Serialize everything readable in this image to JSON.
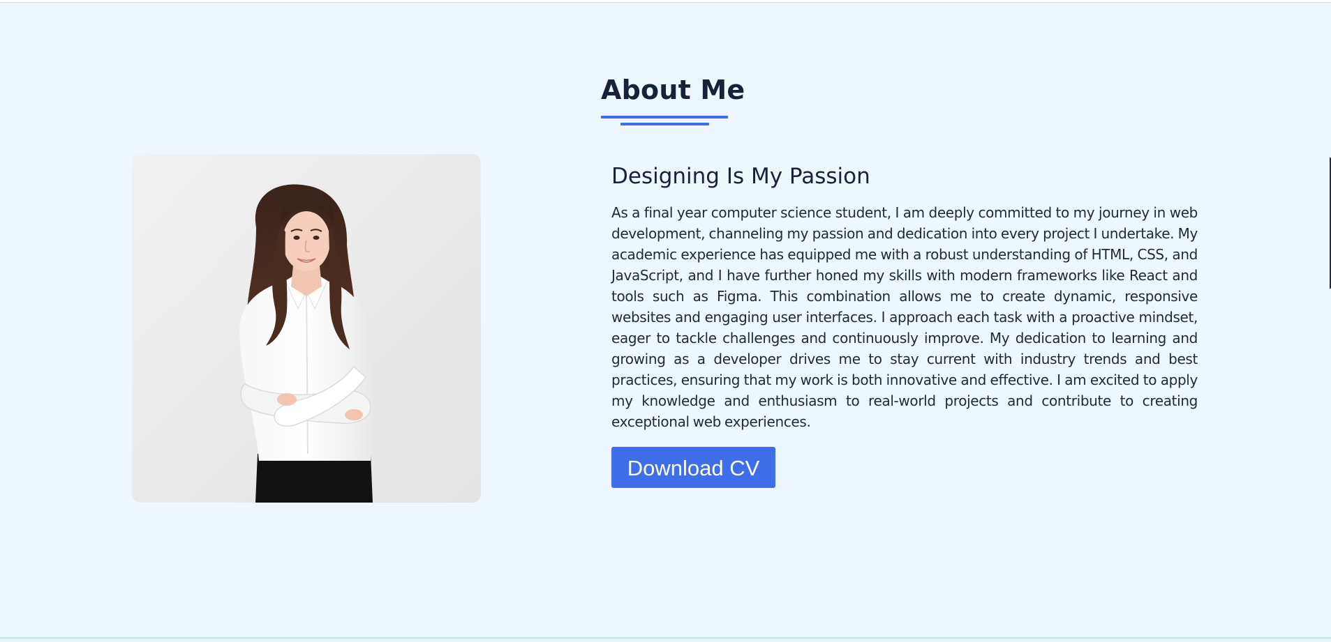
{
  "about": {
    "title": "About Me",
    "photo_alt": "Portrait of a smiling woman with long wavy brown hair in a white shirt, arms crossed",
    "headline": "Designing Is My Passion",
    "bio": "As a final year computer science student, I am deeply committed to my journey in web development, channeling my passion and dedication into every project I undertake. My academic experience has equipped me with a robust understanding of HTML, CSS, and JavaScript, and I have further honed my skills with modern frameworks like React and tools such as Figma. This combination allows me to create dynamic, responsive websites and engaging user interfaces. I approach each task with a proactive mindset, eager to tackle challenges and continuously improve. My dedication to learning and growing as a developer drives me to stay current with industry trends and best practices, ensuring that my work is both innovative and effective. I am excited to apply my knowledge and enthusiasm to real-world projects and contribute to creating exceptional web experiences.",
    "cv_button_label": "Download CV"
  },
  "colors": {
    "page_background": "#eef6fe",
    "accent": "#3f6fe8",
    "heading_text": "#15233a",
    "body_text": "#1f2937",
    "button_text": "#ffffff"
  }
}
